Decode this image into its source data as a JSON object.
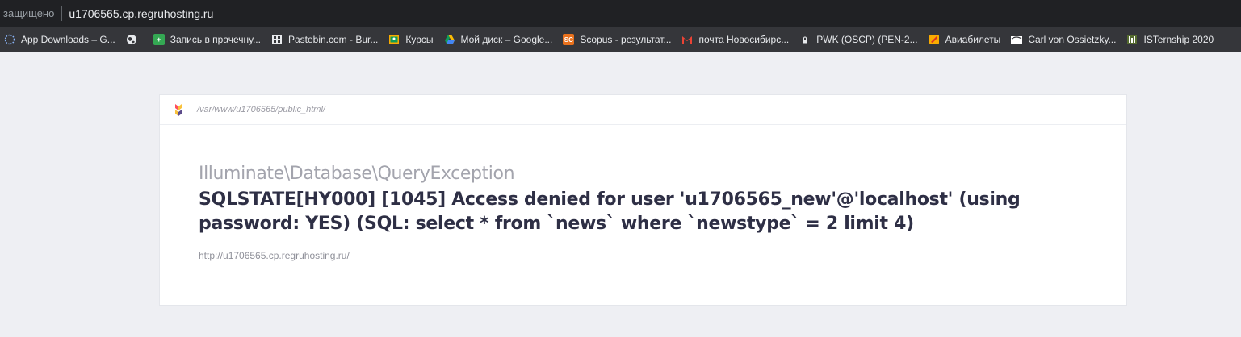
{
  "address_bar": {
    "secure_label": "защищено",
    "url": "u1706565.cp.regruhosting.ru"
  },
  "bookmarks": [
    {
      "label": "App Downloads – G...",
      "icon": "dotted-circle-icon",
      "color": "#8ab4f8"
    },
    {
      "label": "",
      "icon": "globe-icon",
      "color": "#e8eaed"
    },
    {
      "label": "Запись в прачечну...",
      "icon": "plus-doc-icon",
      "color": "#34a853"
    },
    {
      "label": "Pastebin.com - Bur...",
      "icon": "pastebin-icon",
      "color": "#e8eaed"
    },
    {
      "label": "Курсы",
      "icon": "classroom-icon",
      "color": "#f9ab00"
    },
    {
      "label": "Мой диск – Google...",
      "icon": "google-drive-icon",
      "color": "#4285f4"
    },
    {
      "label": "Scopus - результат...",
      "icon": "scopus-icon",
      "color": "#e9711c"
    },
    {
      "label": "почта Новосибирс...",
      "icon": "gmail-icon",
      "color": "#ea4335"
    },
    {
      "label": "PWK (OSCP) (PEN-2...",
      "icon": "lock-icon",
      "color": "#e8eaed"
    },
    {
      "label": "Авиабилеты",
      "icon": "ticket-icon",
      "color": "#f9ab00"
    },
    {
      "label": "Carl von Ossietzky...",
      "icon": "university-icon",
      "color": "#ffffff"
    },
    {
      "label": "ISTernship 2020",
      "icon": "isternship-icon",
      "color": "#6b8e23"
    }
  ],
  "error_page": {
    "path": "/var/www/u1706565/public_html/",
    "exception_class": "Illuminate\\Database\\QueryException",
    "message": "SQLSTATE[HY000] [1045] Access denied for user 'u1706565_new'@'localhost' (using password: YES) (SQL: select * from `news` where `newstype` = 2 limit 4)",
    "url": "http://u1706565.cp.regruhosting.ru/"
  }
}
